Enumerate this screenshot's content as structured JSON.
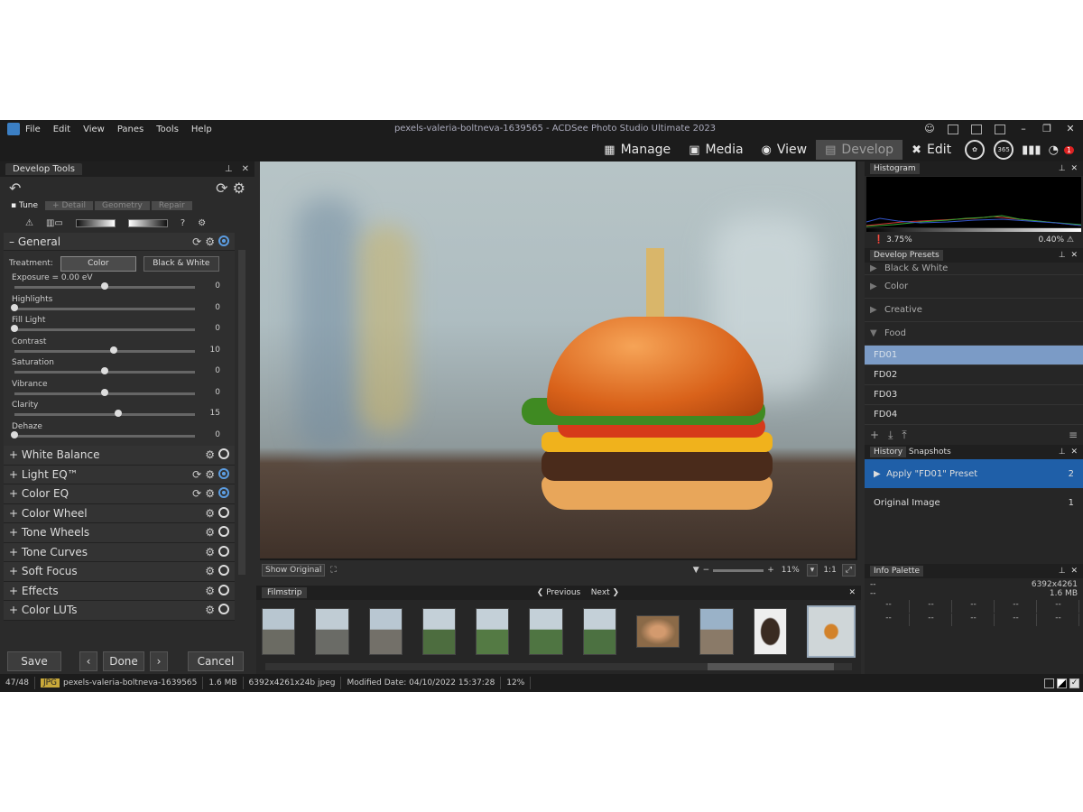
{
  "titlebar": {
    "menu": [
      "File",
      "Edit",
      "View",
      "Panes",
      "Tools",
      "Help"
    ],
    "title": "pexels-valeria-boltneva-1639565 - ACDSee Photo Studio Ultimate 2023"
  },
  "modes": {
    "manage": "Manage",
    "media": "Media",
    "view": "View",
    "develop": "Develop",
    "edit": "Edit",
    "circle": "365",
    "badge": "1"
  },
  "left": {
    "title": "Develop Tools",
    "tabs": [
      "Tune",
      "Detail",
      "Geometry",
      "Repair"
    ],
    "general": {
      "title": "General",
      "treatment_label": "Treatment:",
      "color": "Color",
      "bw": "Black & White",
      "sliders": [
        {
          "label": "Exposure = 0.00 eV",
          "value": "0",
          "pos": 0.5
        },
        {
          "label": "Highlights",
          "value": "0",
          "pos": 0
        },
        {
          "label": "Fill Light",
          "value": "0",
          "pos": 0
        },
        {
          "label": "Contrast",
          "value": "10",
          "pos": 0.55
        },
        {
          "label": "Saturation",
          "value": "0",
          "pos": 0.5
        },
        {
          "label": "Vibrance",
          "value": "0",
          "pos": 0.5
        },
        {
          "label": "Clarity",
          "value": "15",
          "pos": 0.575
        },
        {
          "label": "Dehaze",
          "value": "0",
          "pos": 0
        }
      ]
    },
    "sections": [
      "White Balance",
      "Light EQ™",
      "Color EQ",
      "Color Wheel",
      "Tone Wheels",
      "Tone Curves",
      "Soft Focus",
      "Effects",
      "Color LUTs"
    ],
    "save": "Save",
    "done": "Done",
    "cancel": "Cancel"
  },
  "center": {
    "show_original": "Show Original",
    "zoom": "11%",
    "ratio": "1:1"
  },
  "filmstrip": {
    "title": "Filmstrip",
    "previous": "Previous",
    "next": "Next"
  },
  "right": {
    "histogram": {
      "title": "Histogram",
      "left": "3.75%",
      "right": "0.40%"
    },
    "presets": {
      "title": "Develop Presets",
      "groups": [
        "Black & White",
        "Color",
        "Creative",
        "Food"
      ],
      "items": [
        "FD01",
        "FD02",
        "FD03",
        "FD04"
      ]
    },
    "history": {
      "tab1": "History",
      "tab2": "Snapshots",
      "items": [
        {
          "label": "Apply \"FD01\" Preset",
          "n": "2"
        },
        {
          "label": "Original Image",
          "n": "1"
        }
      ]
    },
    "info": {
      "title": "Info Palette",
      "dims": "6392x4261",
      "size": "1.6 MB",
      "dash": "--"
    }
  },
  "status": {
    "index": "47/48",
    "type": "JPG",
    "name": "pexels-valeria-boltneva-1639565",
    "size": "1.6 MB",
    "info": "6392x4261x24b jpeg",
    "modified": "Modified Date: 04/10/2022 15:37:28",
    "zoom": "12%"
  }
}
